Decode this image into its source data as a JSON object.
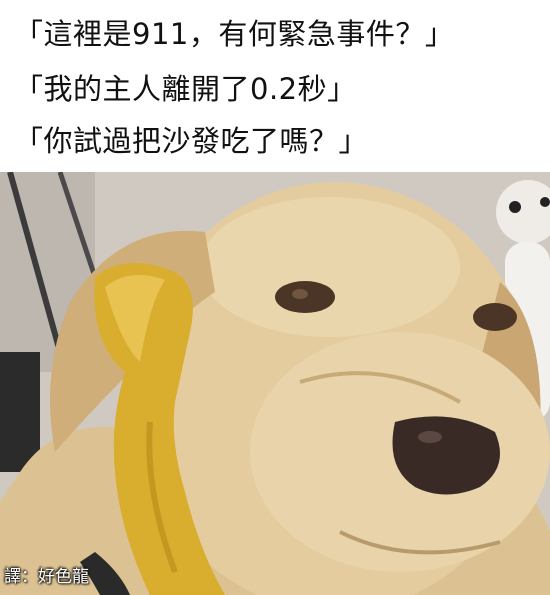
{
  "captions": [
    "「這裡是911，有何緊急事件？」",
    "「我的主人離開了0.2秒」",
    "「你試過把沙發吃了嗎？」"
  ],
  "credit": "譯：好色龍",
  "photo": {
    "subject": "dog-with-telephone",
    "colors": {
      "background": "#cfc9c2",
      "fur": "#e2c99c",
      "fur_shadow": "#b99a6c",
      "receiver": "#d9ad2e",
      "nose": "#3a2a26"
    }
  }
}
